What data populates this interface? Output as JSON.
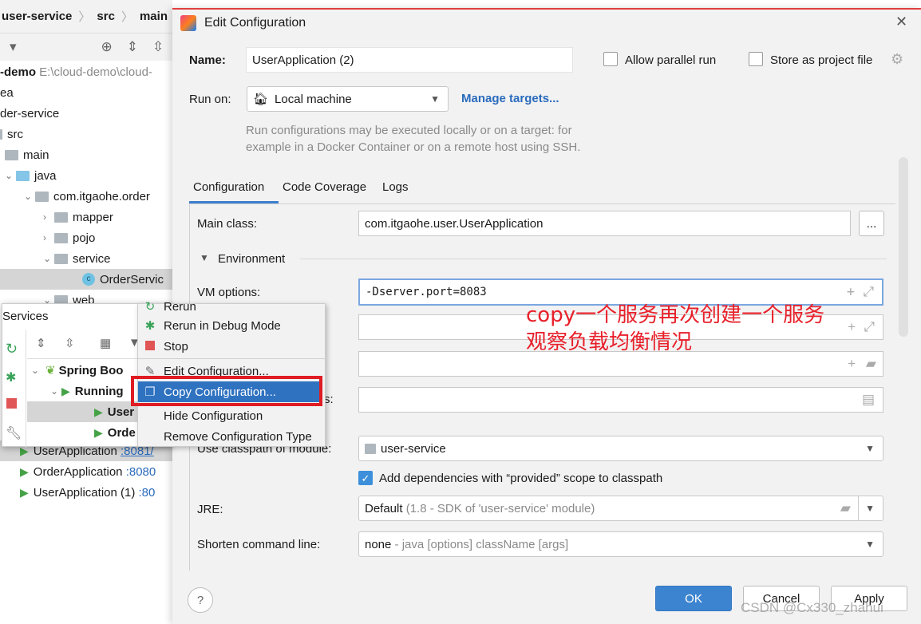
{
  "ide": {
    "breadcrumb": [
      "user-service",
      "src",
      "main"
    ],
    "tree": [
      {
        "label": "-demo",
        "extra": "E:\\cloud-demo\\cloud-"
      },
      {
        "label": "ea"
      },
      {
        "label": "der-service"
      },
      {
        "label": "src"
      },
      {
        "label": "main"
      },
      {
        "label": "java"
      },
      {
        "label": "com.itgaohe.order"
      },
      {
        "label": "mapper"
      },
      {
        "label": "pojo"
      },
      {
        "label": "service"
      },
      {
        "label": "OrderServic"
      },
      {
        "label": "web"
      }
    ],
    "services_title": "Services",
    "services_tree": [
      {
        "label": "Spring Boo"
      },
      {
        "label": "Running"
      },
      {
        "label": "User"
      },
      {
        "label": "Orde"
      }
    ],
    "apps": [
      {
        "name": "UserApplication",
        "port": ":8081/"
      },
      {
        "name": "OrderApplication",
        "port": ":8080"
      },
      {
        "name": "UserApplication (1)",
        "port": ":80"
      }
    ]
  },
  "context_menu": {
    "items": [
      {
        "label": "Rerun",
        "icon": "rerun-icon"
      },
      {
        "label": "Rerun in Debug Mode",
        "icon": "debug-icon"
      },
      {
        "label": "Stop",
        "icon": "stop-icon"
      },
      {
        "label": "Edit Configuration...",
        "icon": "pencil-icon"
      },
      {
        "label": "Copy Configuration...",
        "icon": "copy-icon",
        "highlighted": true
      },
      {
        "label": "Hide Configuration"
      },
      {
        "label": "Remove Configuration Type"
      }
    ]
  },
  "dialog": {
    "title": "Edit Configuration",
    "name_label": "Name:",
    "name_value": "UserApplication (2)",
    "allow_parallel": {
      "label": "Allow parallel run",
      "checked": false
    },
    "store_project": {
      "label": "Store as project file",
      "checked": false
    },
    "run_on_label": "Run on:",
    "run_on_value": "Local machine",
    "manage_targets": "Manage targets...",
    "run_hint_1": "Run configurations may be executed locally or on a target: for",
    "run_hint_2": "example in a Docker Container or on a remote host using SSH.",
    "tabs": [
      {
        "label": "Configuration",
        "active": true
      },
      {
        "label": "Code Coverage"
      },
      {
        "label": "Logs"
      }
    ],
    "main_class_label": "Main class:",
    "main_class_value": "com.itgaohe.user.UserApplication",
    "browse_label": "...",
    "environment_label": "Environment",
    "vm_options_label": "VM options:",
    "vm_options_value": "-Dserver.port=8083",
    "hidden_label_suffix": "s:",
    "classpath_label": "Use classpath of module:",
    "classpath_value": "user-service",
    "provided_checkbox": {
      "label": "Add dependencies with “provided” scope to classpath",
      "checked": true
    },
    "jre_label": "JRE:",
    "jre_value": "Default",
    "jre_hint": "(1.8 - SDK of 'user-service' module)",
    "shorten_label": "Shorten command line:",
    "shorten_value": "none",
    "shorten_hint": "- java [options] className [args]",
    "ok": "OK",
    "cancel": "Cancel",
    "apply": "Apply",
    "help": "?"
  },
  "annotation": {
    "line1": "copy一个服务再次创建一个服务",
    "line2": "观察负载均衡情况"
  },
  "watermark": "CSDN @Cx330_zhahui",
  "colors": {
    "accent": "#2f72c0",
    "annotation": "#e8202a",
    "highlight_box": "#e01c23"
  }
}
